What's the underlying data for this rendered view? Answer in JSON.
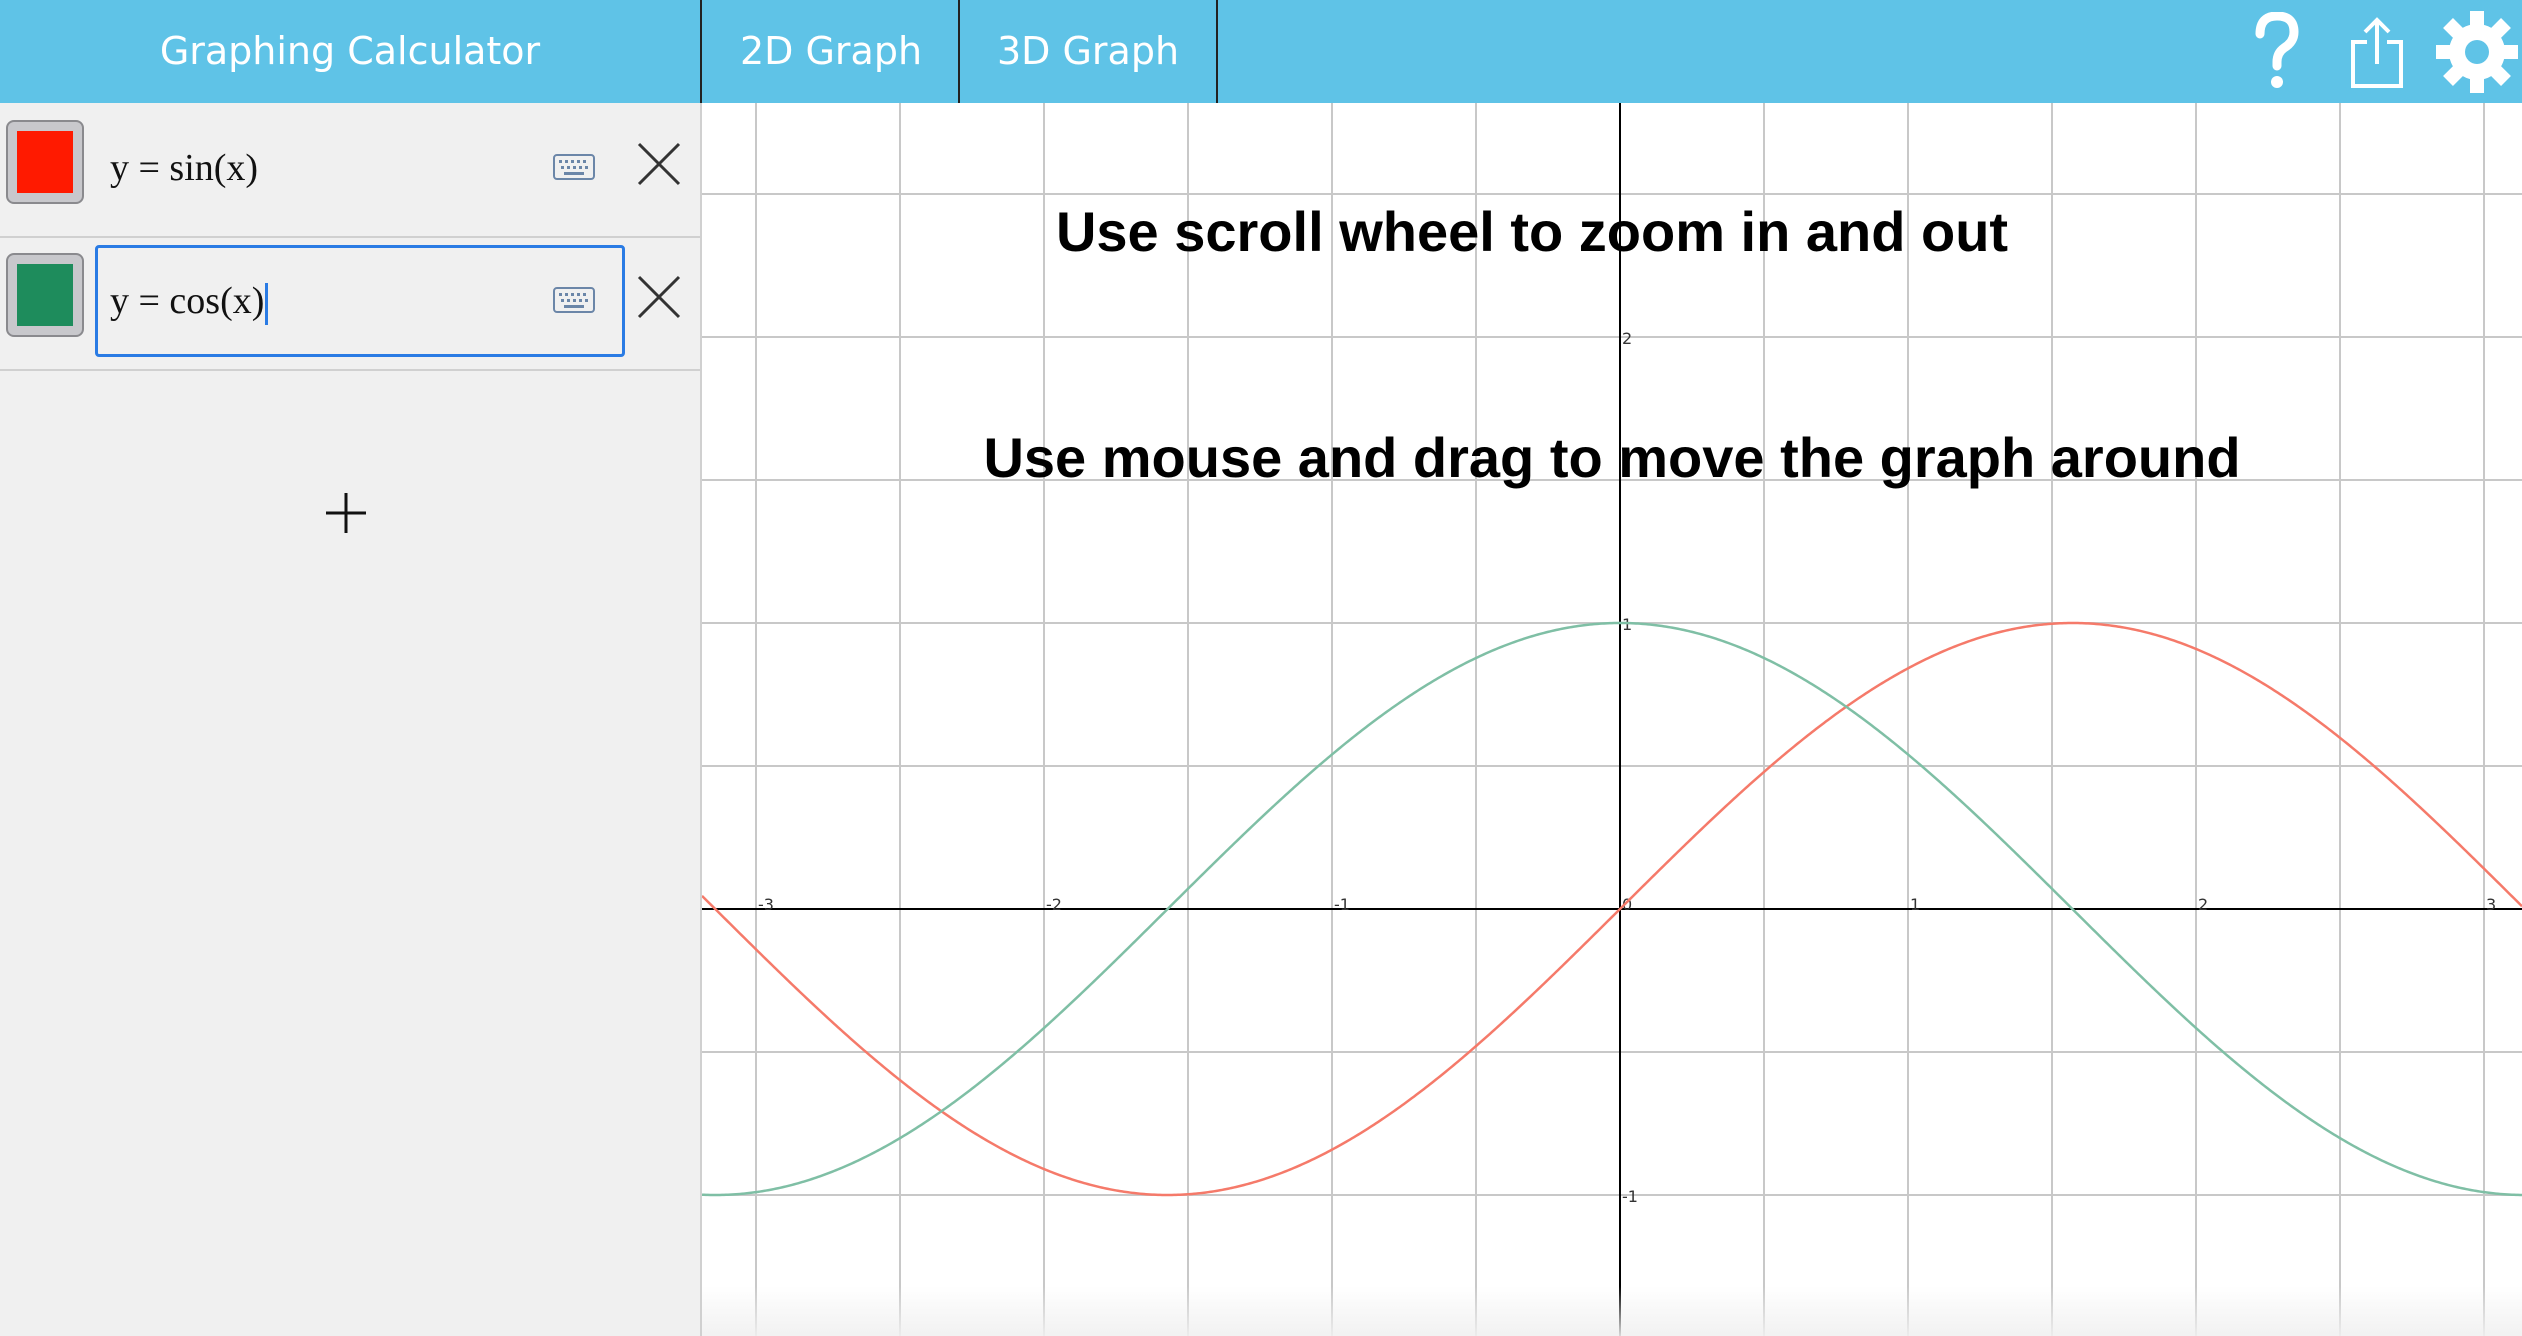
{
  "header": {
    "title": "Graphing Calculator",
    "tabs": [
      {
        "label": "2D Graph",
        "active": true
      },
      {
        "label": "3D Graph",
        "active": false
      }
    ],
    "icons": [
      "help-icon",
      "share-icon",
      "gear-icon"
    ],
    "background": "#5fc3e7"
  },
  "expressions": [
    {
      "text": "y = sin(x)",
      "color": "#ff1a00",
      "curve_color": "#f57a6a",
      "active": false
    },
    {
      "text": "y = cos(x)",
      "color": "#1e8c5c",
      "curve_color": "#7fbfa5",
      "active": true
    }
  ],
  "graph": {
    "hints": {
      "zoom": "Use scroll wheel to zoom in and out",
      "drag": "Use mouse and drag to move the graph around"
    },
    "x_range": [
      -3.2,
      3.2
    ],
    "y_range": [
      -1.5,
      2.0
    ],
    "x_ticks": [
      "-3",
      "-2",
      "-1",
      "0",
      "1",
      "2",
      "3"
    ],
    "y_ticks": [
      "2",
      "1",
      "-1"
    ],
    "grid": true
  },
  "chart_data": {
    "type": "line",
    "title": "",
    "xlabel": "",
    "ylabel": "",
    "xlim": [
      -3.2,
      3.2
    ],
    "ylim": [
      -1.5,
      2.0
    ],
    "grid": true,
    "series": [
      {
        "name": "y = sin(x)",
        "function": "sin(x)",
        "color": "#f57a6a"
      },
      {
        "name": "y = cos(x)",
        "function": "cos(x)",
        "color": "#7fbfa5"
      }
    ]
  }
}
